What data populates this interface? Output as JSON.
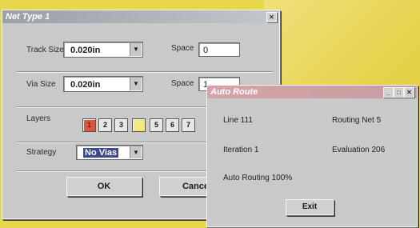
{
  "net_dialog": {
    "title": "Net Type 1",
    "track_size_label": "Track Size",
    "track_size_value": "0.020in",
    "track_space_label": "Space",
    "track_space_value": "0",
    "via_size_label": "Via Size",
    "via_size_value": "0.020in",
    "via_space_label": "Space",
    "via_space_value": "1",
    "layers_label": "Layers",
    "layers": [
      "1",
      "2",
      "3",
      "",
      "5",
      "6",
      "7"
    ],
    "strategy_label": "Strategy",
    "strategy_value": "No Vias",
    "ok_label": "OK",
    "cancel_label": "Cancel"
  },
  "status_window": {
    "title": "Auto Route",
    "line": "Line  111",
    "routing_net": "Routing Net  5",
    "iteration": "Iteration  1",
    "evaluation": "Evaluation  206",
    "auto_routing": "Auto Routing 100%",
    "exit_label": "Exit"
  },
  "colors": {
    "background": "#e8d74a",
    "dialog": "#c9c9c9",
    "layer_active": "#d9573f",
    "layer_highlight": "#f2ea7a"
  }
}
